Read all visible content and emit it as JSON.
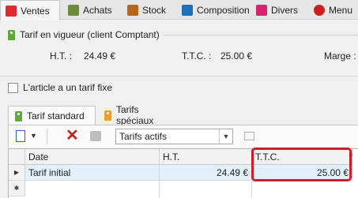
{
  "tabs": [
    {
      "label": "Ventes",
      "icon": "ventes-icon",
      "color": "#e0282e",
      "active": true
    },
    {
      "label": "Achats",
      "icon": "achats-icon",
      "color": "#6e8b3d",
      "active": false
    },
    {
      "label": "Stock",
      "icon": "stock-icon",
      "color": "#b5651d",
      "active": false
    },
    {
      "label": "Composition",
      "icon": "composition-icon",
      "color": "#1f6fb5",
      "active": false
    },
    {
      "label": "Divers",
      "icon": "divers-icon",
      "color": "#d6246e",
      "active": false
    },
    {
      "label": "Menu",
      "icon": "menu-icon",
      "color": "#c9211e",
      "active": false
    }
  ],
  "tarif_vigueur": {
    "title": "Tarif en vigueur (client Comptant)",
    "ht_label": "H.T. :",
    "ht_value": "24.49 €",
    "ttc_label": "T.T.C. :",
    "ttc_value": "25.00 €",
    "marge_label": "Marge :"
  },
  "fixed_price": {
    "label": "L'article a un tarif fixe",
    "checked": false
  },
  "subtabs": [
    {
      "label": "Tarif standard",
      "active": true
    },
    {
      "label": "Tarifs spéciaux",
      "active": false
    }
  ],
  "toolbar": {
    "filter_value": "Tarifs actifs"
  },
  "grid": {
    "columns": [
      "Date",
      "H.T.",
      "T.T.C."
    ],
    "rows": [
      {
        "date": "Tarif initial",
        "ht": "24.49 €",
        "ttc": "25.00 €"
      }
    ]
  },
  "colors": {
    "highlight": "#cc1f2b",
    "selected_row": "#e3f0fb"
  }
}
